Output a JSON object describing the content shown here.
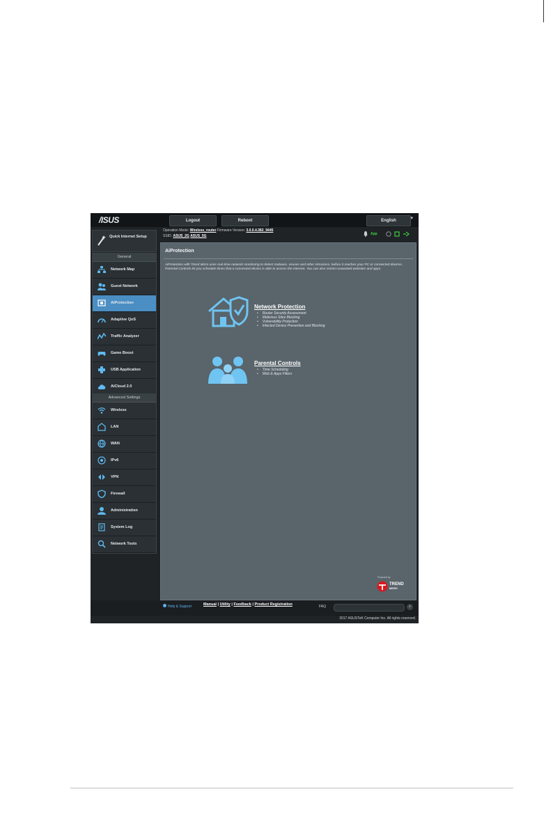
{
  "brand": {
    "logo": "/ISUS"
  },
  "topbar": {
    "logout": "Logout",
    "reboot": "Reboot",
    "language": "English"
  },
  "status": {
    "op_mode_label": "Operation Mode:",
    "op_mode_value": "Wireless_router",
    "firmware_label": "Firmware Version:",
    "firmware_value": "3.0.0.4.382_9445",
    "ssid_label": "SSID:",
    "ssid_1": "ASUS_2G",
    "ssid_2": "ASUS_5G",
    "app_label": "App"
  },
  "sidebar": {
    "qis_label": "Quick Internet Setup",
    "general_header": "General",
    "general_items": [
      {
        "label": "Network Map",
        "icon": "network-map-icon"
      },
      {
        "label": "Guest Network",
        "icon": "guest-network-icon"
      },
      {
        "label": "AiProtection",
        "icon": "aiprotection-icon",
        "active": true
      },
      {
        "label": "Adaptive QoS",
        "icon": "qos-icon"
      },
      {
        "label": "Traffic Analyzer",
        "icon": "traffic-analyzer-icon"
      },
      {
        "label": "Game Boost",
        "icon": "game-boost-icon"
      },
      {
        "label": "USB Application",
        "icon": "usb-application-icon"
      },
      {
        "label": "AiCloud 2.0",
        "icon": "aicloud-icon"
      }
    ],
    "advanced_header": "Advanced Settings",
    "advanced_items": [
      {
        "label": "Wireless",
        "icon": "wireless-icon"
      },
      {
        "label": "LAN",
        "icon": "lan-icon"
      },
      {
        "label": "WAN",
        "icon": "wan-icon"
      },
      {
        "label": "IPv6",
        "icon": "ipv6-icon"
      },
      {
        "label": "VPN",
        "icon": "vpn-icon"
      },
      {
        "label": "Firewall",
        "icon": "firewall-icon"
      },
      {
        "label": "Administration",
        "icon": "administration-icon"
      },
      {
        "label": "System Log",
        "icon": "system-log-icon"
      },
      {
        "label": "Network Tools",
        "icon": "network-tools-icon"
      }
    ]
  },
  "main": {
    "title": "AiProtection",
    "description": "AiProtection with Trend Micro uses real-time network monitoring to detect malware, viruses and other intrusions, before it reaches your PC or connected devices. Parental Controls let you schedule times that a connected device is able to access the Internet. You can also restrict unwanted websites and apps.",
    "network_protection": {
      "title": "Network Protection",
      "items": [
        "Router Security Assessment",
        "Malicious Sites Blocking",
        "Vulnerability Protection",
        "Infected Device Prevention and Blocking"
      ]
    },
    "parental_controls": {
      "title": "Parental Controls",
      "items": [
        "Time Scheduling",
        "Web & Apps Filters"
      ]
    },
    "trend": {
      "powered_by": "Powered by",
      "line1": "TREND",
      "line2": "MICRO"
    }
  },
  "footer": {
    "help_support": "Help & Support",
    "links": [
      "Manual",
      "Utility",
      "Feedback",
      "Product Registration"
    ],
    "faq_label": "FAQ",
    "copyright": "2017 ASUSTeK Computer Inc. All rights reserved."
  },
  "colors": {
    "accent": "#4a8ec4",
    "panel": "#59646b",
    "icon_blue": "#5fb8ee"
  }
}
